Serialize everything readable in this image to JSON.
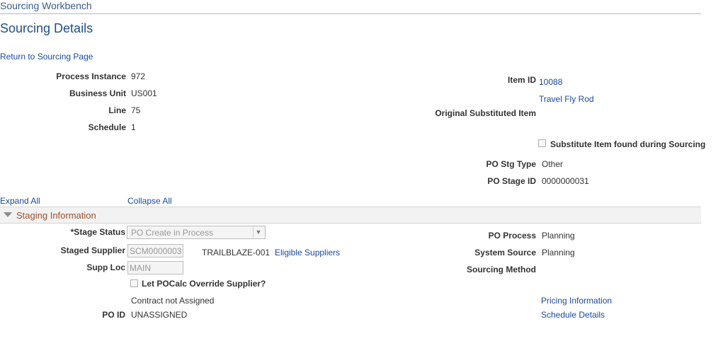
{
  "breadcrumb": "Sourcing Workbench",
  "page_title": "Sourcing Details",
  "return_link": "Return to Sourcing Page",
  "left_fields": [
    {
      "label": "Process Instance",
      "value": "972"
    },
    {
      "label": "Business Unit",
      "value": "US001"
    },
    {
      "label": "Line",
      "value": "75"
    },
    {
      "label": "Schedule",
      "value": "1"
    }
  ],
  "item": {
    "id_label": "Item ID",
    "id_value": "10088",
    "description": "Travel Fly Rod",
    "original_substituted_label": "Original Substituted Item",
    "substitute_checkbox_label": "Substitute Item found during Sourcing",
    "po_stg_type_label": "PO Stg Type",
    "po_stg_type_value": "Other",
    "po_stage_id_label": "PO Stage ID",
    "po_stage_id_value": "0000000031"
  },
  "expand_all": "Expand All",
  "collapse_all": "Collapse All",
  "section": {
    "title": "Staging Information",
    "stage_status_label": "*Stage Status",
    "stage_status_value": "PO Create in Process",
    "staged_supplier_label": "Staged Supplier",
    "staged_supplier_value": "SCM0000003",
    "supplier_name": "TRAILBLAZE-001",
    "eligible_suppliers_link": "Eligible Suppliers",
    "supp_loc_label": "Supp Loc",
    "supp_loc_value": "MAIN",
    "override_checkbox_label": "Let POCalc Override Supplier?",
    "contract_text": "Contract not Assigned",
    "po_id_label": "PO ID",
    "po_id_value": "UNASSIGNED",
    "po_process_label": "PO Process",
    "po_process_value": "Planning",
    "system_source_label": "System Source",
    "system_source_value": "Planning",
    "sourcing_method_label": "Sourcing Method",
    "pricing_info_link": "Pricing Information",
    "schedule_details_link": "Schedule Details"
  }
}
